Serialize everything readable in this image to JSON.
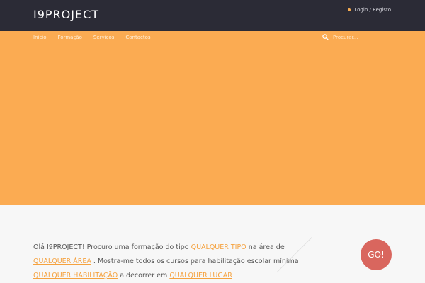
{
  "header": {
    "logo": "I9PROJECT",
    "login_label": "Login / Registo"
  },
  "nav": {
    "items": [
      {
        "label": "Início"
      },
      {
        "label": "Formação"
      },
      {
        "label": "Serviços"
      },
      {
        "label": "Contactos"
      }
    ]
  },
  "search": {
    "placeholder": "Procurar..."
  },
  "finder": {
    "intro": "Olá I9PROJECT! Procuro uma formação do tipo",
    "type_link": "QUALQUER TIPO",
    "area_text": "na área de",
    "area_link": "QUALQUER ÁREA",
    "habilitacao_text": ". Mostra-me todos os cursos para habilitação escolar mínima",
    "habilitacao_link": "QUALQUER HABILITAÇÃO",
    "lugar_text": "a decorrer em",
    "lugar_link": "QUALQUER LUGAR",
    "go_label": "GO!"
  },
  "colors": {
    "header_bg": "#2b2b36",
    "hero_bg": "#fbab52",
    "link": "#f5a23f",
    "go_button": "#d9665e"
  }
}
